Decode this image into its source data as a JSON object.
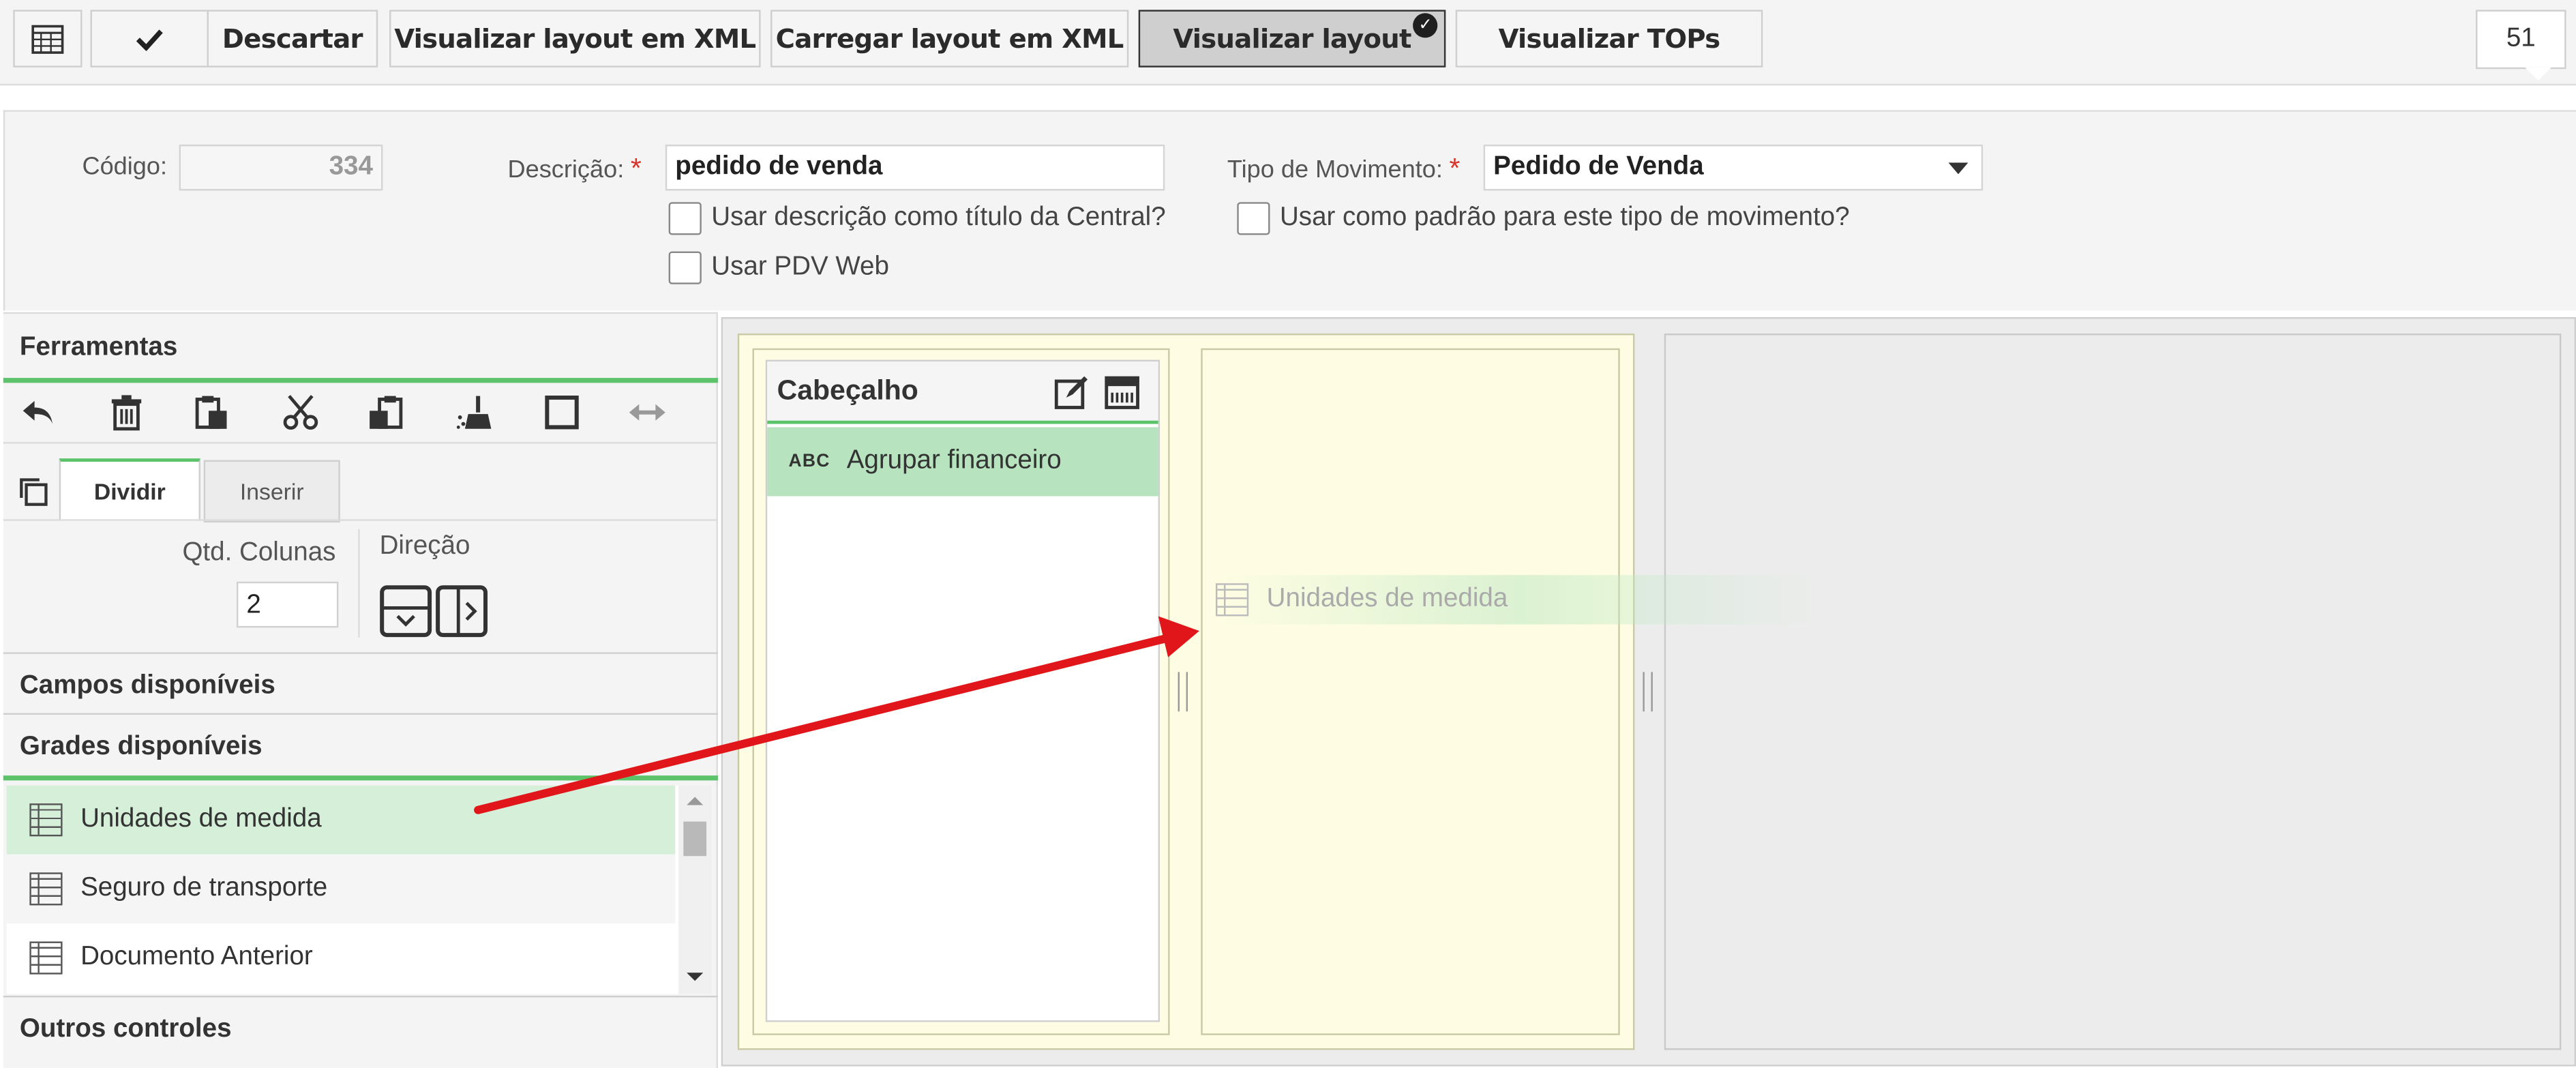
{
  "toolbar": {
    "buttons": {
      "grid_icon": "grid-icon",
      "confirm_icon": "check-icon",
      "discard": "Descartar",
      "view_xml": "Visualizar layout em XML",
      "load_xml": "Carregar layout em XML",
      "view_layout": "Visualizar layout",
      "view_tops": "Visualizar TOPs"
    },
    "counter": "51"
  },
  "form": {
    "codigo_label": "Código:",
    "codigo_value": "334",
    "descricao_label": "Descrição:",
    "descricao_value": "pedido de venda",
    "tipo_label": "Tipo de Movimento:",
    "tipo_value": "Pedido de Venda",
    "required_mark": "*",
    "chk_titulo": "Usar descrição como título da Central?",
    "chk_padrao": "Usar como padrão para este tipo de movimento?",
    "chk_pdv": "Usar PDV Web"
  },
  "tools": {
    "title": "Ferramentas",
    "icons": [
      "undo-icon",
      "trash-icon",
      "paste-icon",
      "cut-icon",
      "clipboard-icon",
      "broom-icon",
      "square-icon",
      "move-horizontal-icon"
    ],
    "tabs": [
      "Dividir",
      "Inserir"
    ],
    "qtd_label": "Qtd. Colunas",
    "qtd_value": "2",
    "direcao_label": "Direção"
  },
  "sections": {
    "campos": "Campos disponíveis",
    "grades": "Grades disponíveis",
    "outros": "Outros controles"
  },
  "grades_list": [
    {
      "label": "Unidades de medida",
      "selected": true
    },
    {
      "label": "Seguro de transporte",
      "selected": false
    },
    {
      "label": "Documento Anterior",
      "selected": false
    }
  ],
  "canvas": {
    "card_title": "Cabeçalho",
    "field": "Agrupar financeiro",
    "field_icon_text": "ABC",
    "ghost_item": "Unidades de medida"
  },
  "colors": {
    "accent_green": "#5cc36b",
    "selection_green": "#d5efd9",
    "field_green": "#b7e4be",
    "panel_yellow": "#fefde3",
    "annotation_arrow": "#e0161b"
  }
}
